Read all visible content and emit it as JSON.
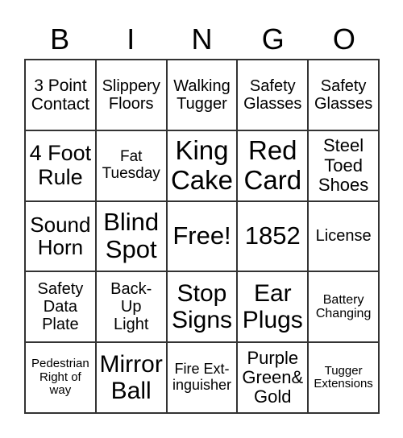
{
  "header": [
    "B",
    "I",
    "N",
    "G",
    "O"
  ],
  "cells": [
    "3 Point\nContact",
    "Slippery\nFloors",
    "Walking\nTugger",
    "Safety\nGlasses",
    "Safety\nGlasses",
    "4 Foot\nRule",
    "Fat\nTuesday",
    "King\nCake",
    "Red\nCard",
    "Steel\nToed\nShoes",
    "Sound\nHorn",
    "Blind\nSpot",
    "Free!",
    "1852",
    "License",
    "Safety\nData\nPlate",
    "Back-\nUp\nLight",
    "Stop\nSigns",
    "Ear\nPlugs",
    "Battery\nChanging",
    "Pedestrian\nRight of\nway",
    "Mirror\nBall",
    "Fire Ext-\ninguisher",
    "Purple\nGreen&\nGold",
    "Tugger\nExtensions"
  ]
}
